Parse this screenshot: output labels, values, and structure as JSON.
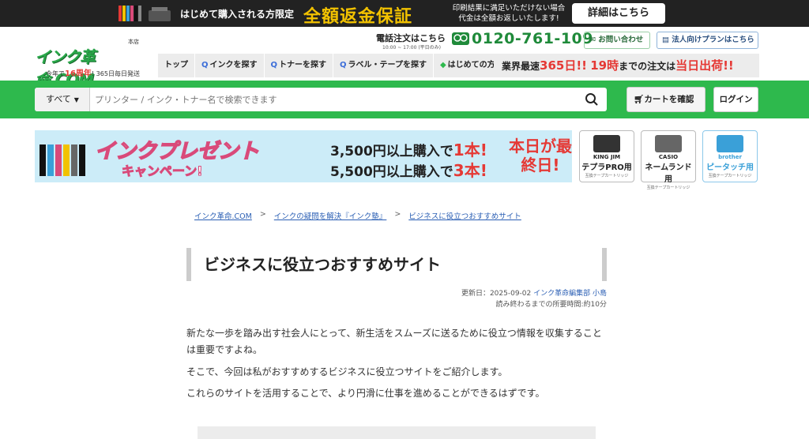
{
  "promo": {
    "first_buy": "はじめて購入される方限定",
    "guarantee": "全額返金保証",
    "desc_1": "印刷結果に満足いただけない場合",
    "desc_2": "代金は全額お返しいたします!",
    "detail_btn": "詳細はこちら"
  },
  "header": {
    "logo_shop": "本店",
    "logo_name": "インク革命.COM",
    "logo_tag_pre": "今年で",
    "logo_tag_year": "16周年",
    "logo_tag_post": "! 365日毎日発送",
    "tel_label": "電話注文はこちら",
    "tel_hours": "10:00 ~ 17:00 (平日のみ)",
    "tel_number": "0120-761-109",
    "contact": "お問い合わせ",
    "corp": "法人向けプランはこちら",
    "nav": [
      "トップ",
      "インクを探す",
      "トナーを探す",
      "ラベル・テープを探す",
      "はじめての方"
    ],
    "ship_pre": "業界最速",
    "ship_days": "365日!!",
    "ship_hour": "19時",
    "ship_mid": "までの注文は",
    "ship_today": "当日出荷!!"
  },
  "search": {
    "category": "すべて",
    "placeholder": "プリンター / インク・トナー名で検索できます",
    "cart": "カートを確認",
    "login": "ログイン"
  },
  "campaign": {
    "title": "インクプレゼント",
    "subtitle": "キャンペーン!",
    "offer_1_pre": "3,500円以上購入で",
    "offer_1_val": "1本!",
    "offer_2_pre": "5,500円以上購入で",
    "offer_2_val": "3本!",
    "last_day": "本日が最終日!"
  },
  "tapes": [
    {
      "brand": "KING JIM",
      "product": "テプラPRO用",
      "note": "互換テープカートリッジ",
      "color": "#333333"
    },
    {
      "brand": "CASIO",
      "product": "ネームランド用",
      "note": "互換テープカートリッジ",
      "color": "#555555"
    },
    {
      "brand": "brother",
      "product": "ピータッチ用",
      "note": "互換テープカートリッジ",
      "color": "#3aa0d8"
    }
  ],
  "breadcrumb": [
    "インク革命.COM",
    "インクの疑問を解決『インク塾』",
    "ビジネスに役立つおすすめサイト"
  ],
  "breadcrumb_sep": ">",
  "article": {
    "title": "ビジネスに役立つおすすめサイト",
    "updated_pre": "更新日：2025-09-02 ",
    "author": "インク革命編集部 小島",
    "read_time": "読み終わるまでの所要時間:約10分",
    "paragraphs": [
      "新たな一歩を踏み出す社会人にとって、新生活をスムーズに送るために役立つ情報を収集することは重要ですよね。",
      "そこで、今回は私がおすすめするビジネスに役立つサイトをご紹介します。",
      "これらのサイトを活用することで、より円滑に仕事を進めることができるはずです。"
    ]
  }
}
